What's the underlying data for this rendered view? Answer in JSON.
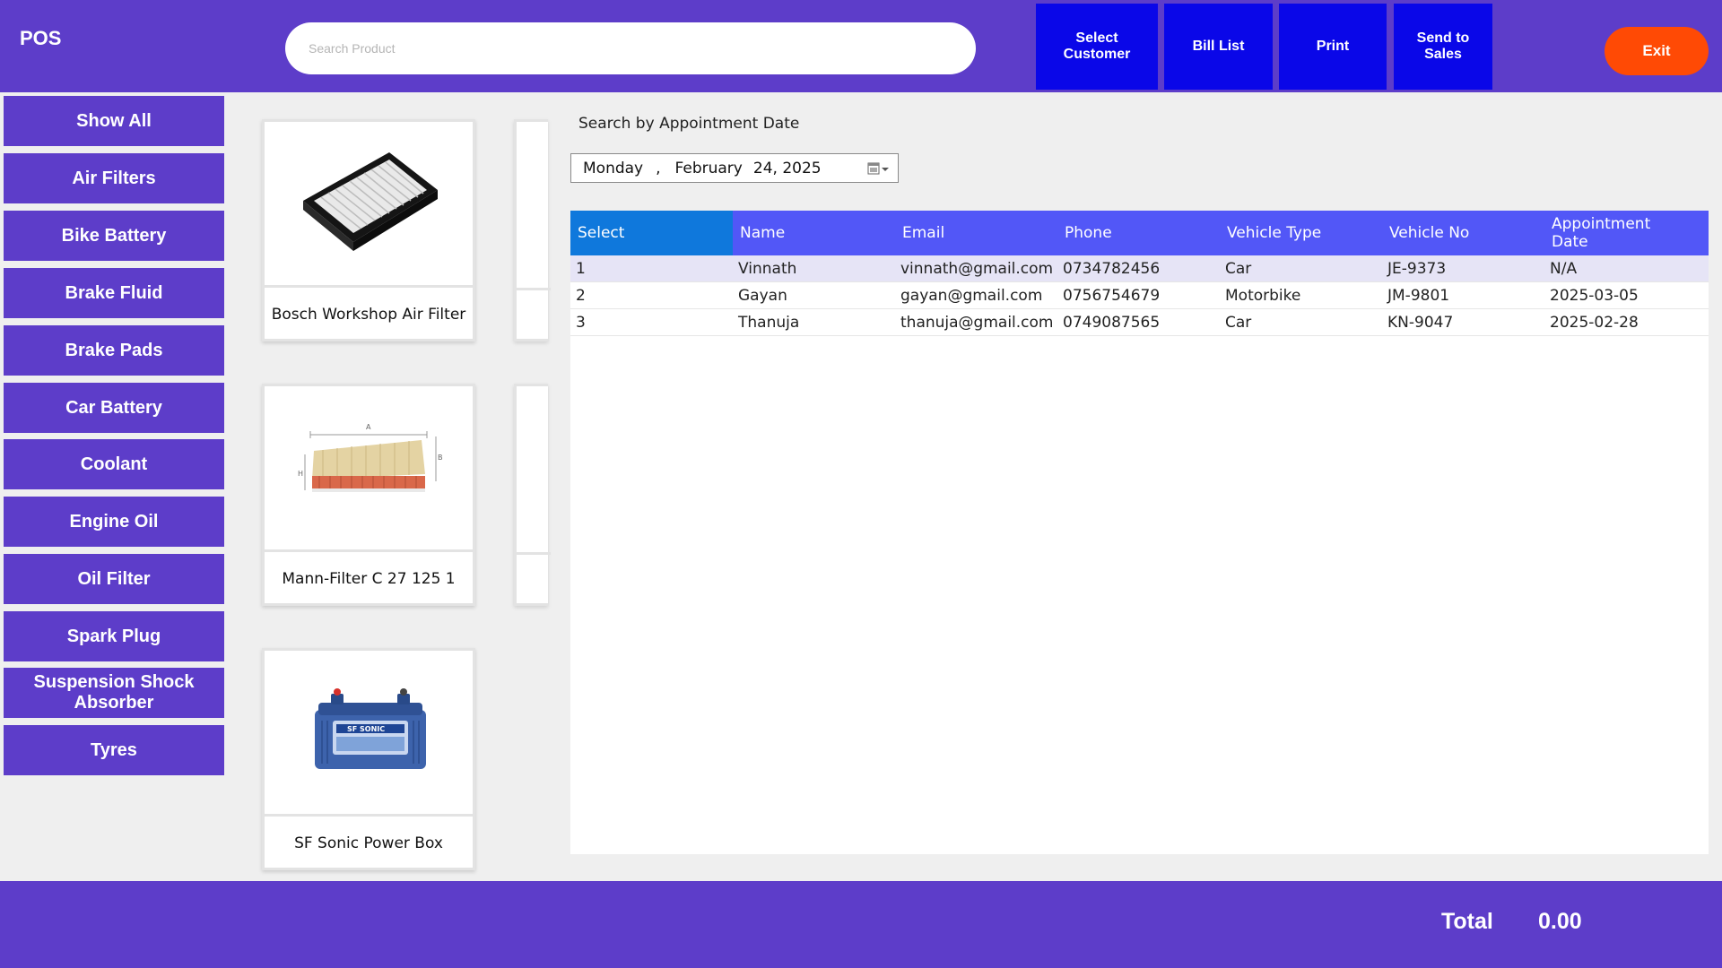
{
  "header": {
    "app_title": "POS",
    "search_placeholder": "Search Product",
    "buttons": {
      "select_customer": "Select Customer",
      "bill_list": "Bill List",
      "print": "Print",
      "send_to_sales": "Send to Sales",
      "exit": "Exit"
    },
    "colors": {
      "bar": "#5d3dc9",
      "action_button": "#0a07e8",
      "exit_button": "#ff4a05"
    }
  },
  "categories": [
    "Show All",
    "Air Filters",
    "Bike Battery",
    "Brake Fluid",
    "Brake Pads",
    "Car Battery",
    "Coolant",
    "Engine Oil",
    "Oil Filter",
    "Spark Plug",
    "Suspension Shock Absorber",
    "Tyres"
  ],
  "products": [
    {
      "name": "Bosch Workshop Air Filter",
      "icon": "air-filter-panel-image"
    },
    {
      "name": "Mann-Filter C 27 125 1",
      "icon": "air-filter-wedge-image"
    },
    {
      "name": "SF Sonic Power Box",
      "icon": "car-battery-image"
    }
  ],
  "appointment_search": {
    "label": "Search by  Appointment Date",
    "date": {
      "weekday": "Monday",
      "separator": ",",
      "month": "February",
      "day_year": "24, 2025"
    }
  },
  "table": {
    "columns": [
      "Select",
      "Name",
      "Email",
      "Phone",
      "Vehicle Type",
      "Vehicle No",
      "Appointment Date"
    ],
    "rows": [
      {
        "select": "1",
        "name": "Vinnath",
        "email": "vinnath@gmail.com",
        "phone": "0734782456",
        "vehicle_type": "Car",
        "vehicle_no": "JE-9373",
        "appointment_date": "N/A"
      },
      {
        "select": "2",
        "name": "Gayan",
        "email": "gayan@gmail.com",
        "phone": "0756754679",
        "vehicle_type": "Motorbike",
        "vehicle_no": "JM-9801",
        "appointment_date": "2025-03-05"
      },
      {
        "select": "3",
        "name": "Thanuja",
        "email": "thanuja@gmail.com",
        "phone": "0749087565",
        "vehicle_type": "Car",
        "vehicle_no": "KN-9047",
        "appointment_date": "2025-02-28"
      }
    ]
  },
  "footer": {
    "total_label": "Total",
    "total_value": "0.00"
  }
}
